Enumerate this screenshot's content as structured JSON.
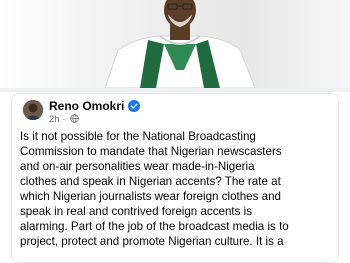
{
  "post": {
    "author": "Reno Omokri",
    "time": "2h",
    "lines": [
      "Is it not possible for the National Broadcasting",
      "Commission to mandate that Nigerian newscasters",
      "and on-air personalities wear made-in-Nigeria",
      "clothes and speak in Nigerian accents? The rate at",
      "which Nigerian journalists wear foreign clothes and",
      "speak in real and contrived foreign accents is",
      "alarming. Part of the job of the broadcast media is to",
      "project, protect and promote Nigerian culture. It is a"
    ]
  },
  "icons": {
    "verified": "verified-badge-icon",
    "privacy": "globe-icon"
  },
  "colors": {
    "verified_blue": "#1877f2",
    "meta_gray": "#65676b",
    "attire_green": "#1f6b3d"
  }
}
